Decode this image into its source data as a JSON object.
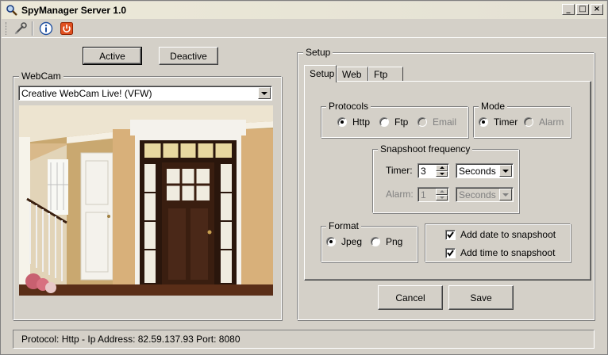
{
  "window": {
    "title": "SpyManager Server 1.0",
    "minimize": "_",
    "maximize": "□",
    "close": "×"
  },
  "toolbar": {
    "items": [
      {
        "icon": "wrench-icon"
      },
      {
        "icon": "info-icon"
      },
      {
        "icon": "power-icon"
      }
    ]
  },
  "controls": {
    "active_label": "Active",
    "deactive_label": "Deactive"
  },
  "webcam": {
    "group_label": "WebCam",
    "selected_device": "Creative WebCam Live! (VFW)"
  },
  "setup": {
    "group_label": "Setup",
    "tabs": [
      {
        "label": "Setup",
        "active": true
      },
      {
        "label": "Web",
        "active": false
      },
      {
        "label": "Ftp",
        "active": false
      }
    ],
    "protocols": {
      "label": "Protocols",
      "options": [
        {
          "label": "Http",
          "selected": true,
          "enabled": true
        },
        {
          "label": "Ftp",
          "selected": false,
          "enabled": true
        },
        {
          "label": "Email",
          "selected": false,
          "enabled": false
        }
      ]
    },
    "mode": {
      "label": "Mode",
      "options": [
        {
          "label": "Timer",
          "selected": true,
          "enabled": true
        },
        {
          "label": "Alarm",
          "selected": false,
          "enabled": false
        }
      ]
    },
    "snapshot_frequency": {
      "label": "Snapshoot frequency",
      "timer_label": "Timer:",
      "timer_value": "3",
      "timer_unit": "Seconds",
      "alarm_label": "Alarm:",
      "alarm_value": "1",
      "alarm_unit": "Seconds"
    },
    "format": {
      "label": "Format",
      "options": [
        {
          "label": "Jpeg",
          "selected": true
        },
        {
          "label": "Png",
          "selected": false
        }
      ]
    },
    "snapshot_options": {
      "add_date": {
        "label": "Add date to snapshoot",
        "checked": true
      },
      "add_time": {
        "label": "Add time to snapshoot",
        "checked": true
      }
    }
  },
  "dialog_buttons": {
    "cancel": "Cancel",
    "save": "Save"
  },
  "status": {
    "text": "Protocol: Http - Ip Address: 82.59.137.93 Port: 8080"
  }
}
